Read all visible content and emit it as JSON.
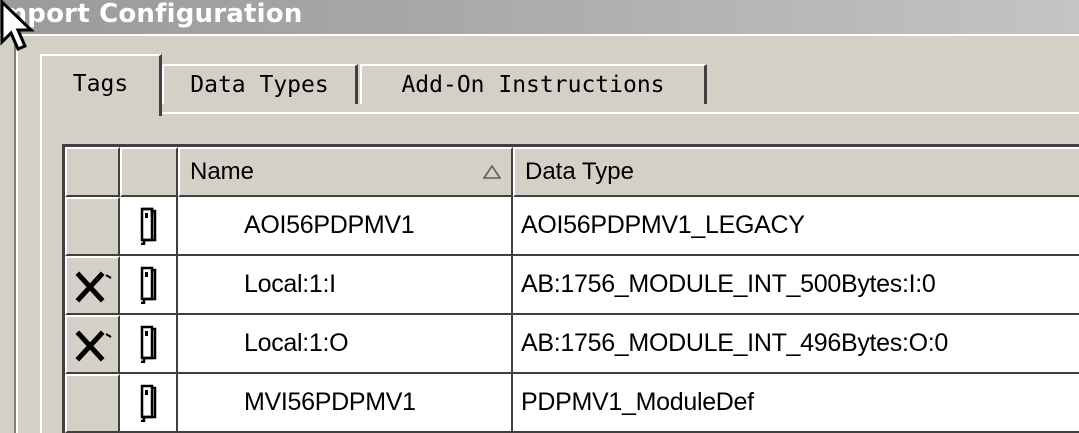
{
  "window": {
    "title": "mport Configuration"
  },
  "tabs": [
    {
      "label": "Tags",
      "active": true
    },
    {
      "label": "Data Types",
      "active": false
    },
    {
      "label": "Add-On Instructions",
      "active": false
    }
  ],
  "table": {
    "columns": [
      "Name",
      "Data Type"
    ],
    "sort": {
      "column": "Name",
      "direction": "ascending"
    },
    "rows": [
      {
        "status": "",
        "name": "AOI56PDPMV1",
        "data_type": "AOI56PDPMV1_LEGACY"
      },
      {
        "status": "delete-icon",
        "name": "Local:1:I",
        "data_type": "AB:1756_MODULE_INT_500Bytes:I:0"
      },
      {
        "status": "delete-icon",
        "name": "Local:1:O",
        "data_type": "AB:1756_MODULE_INT_496Bytes:O:0"
      },
      {
        "status": "",
        "name": "MVI56PDPMV1",
        "data_type": "PDPMV1_ModuleDef"
      }
    ]
  },
  "icons": {
    "row_type": "tag-icon",
    "row_action": "delete-icon",
    "sort": "sort-ascending-icon",
    "cursor": "mouse-pointer-icon"
  },
  "colors": {
    "dialog_face": "#d4d0c8",
    "title_text": "#ffffff",
    "grid_line": "#404040",
    "cell_background": "#ffffff"
  }
}
